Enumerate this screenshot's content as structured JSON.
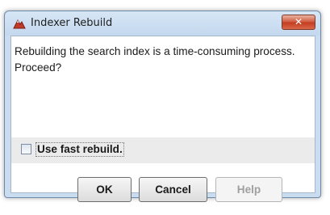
{
  "window": {
    "title": "Indexer Rebuild",
    "close_label": "✕"
  },
  "message": {
    "text": "Rebuilding the search index is a time-consuming process. Proceed?"
  },
  "option": {
    "label": "Use fast rebuild.",
    "checked": false
  },
  "buttons": {
    "ok": "OK",
    "cancel": "Cancel",
    "help": "Help"
  },
  "icons": {
    "app": "app-icon",
    "close": "close-icon"
  }
}
